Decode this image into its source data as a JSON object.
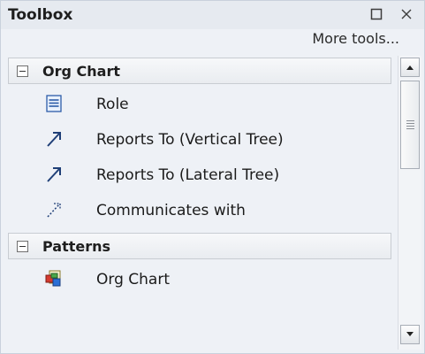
{
  "window": {
    "title": "Toolbox"
  },
  "toolbar": {
    "more_tools": "More tools..."
  },
  "categories": [
    {
      "label": "Org Chart",
      "items": [
        {
          "label": "Role",
          "icon": "role-icon"
        },
        {
          "label": "Reports To (Vertical Tree)",
          "icon": "solid-arrow-icon"
        },
        {
          "label": "Reports To (Lateral Tree)",
          "icon": "solid-arrow-icon"
        },
        {
          "label": "Communicates with",
          "icon": "dashed-arrow-icon"
        }
      ]
    },
    {
      "label": "Patterns",
      "items": [
        {
          "label": "Org Chart",
          "icon": "org-chart-pattern-icon"
        }
      ]
    }
  ]
}
